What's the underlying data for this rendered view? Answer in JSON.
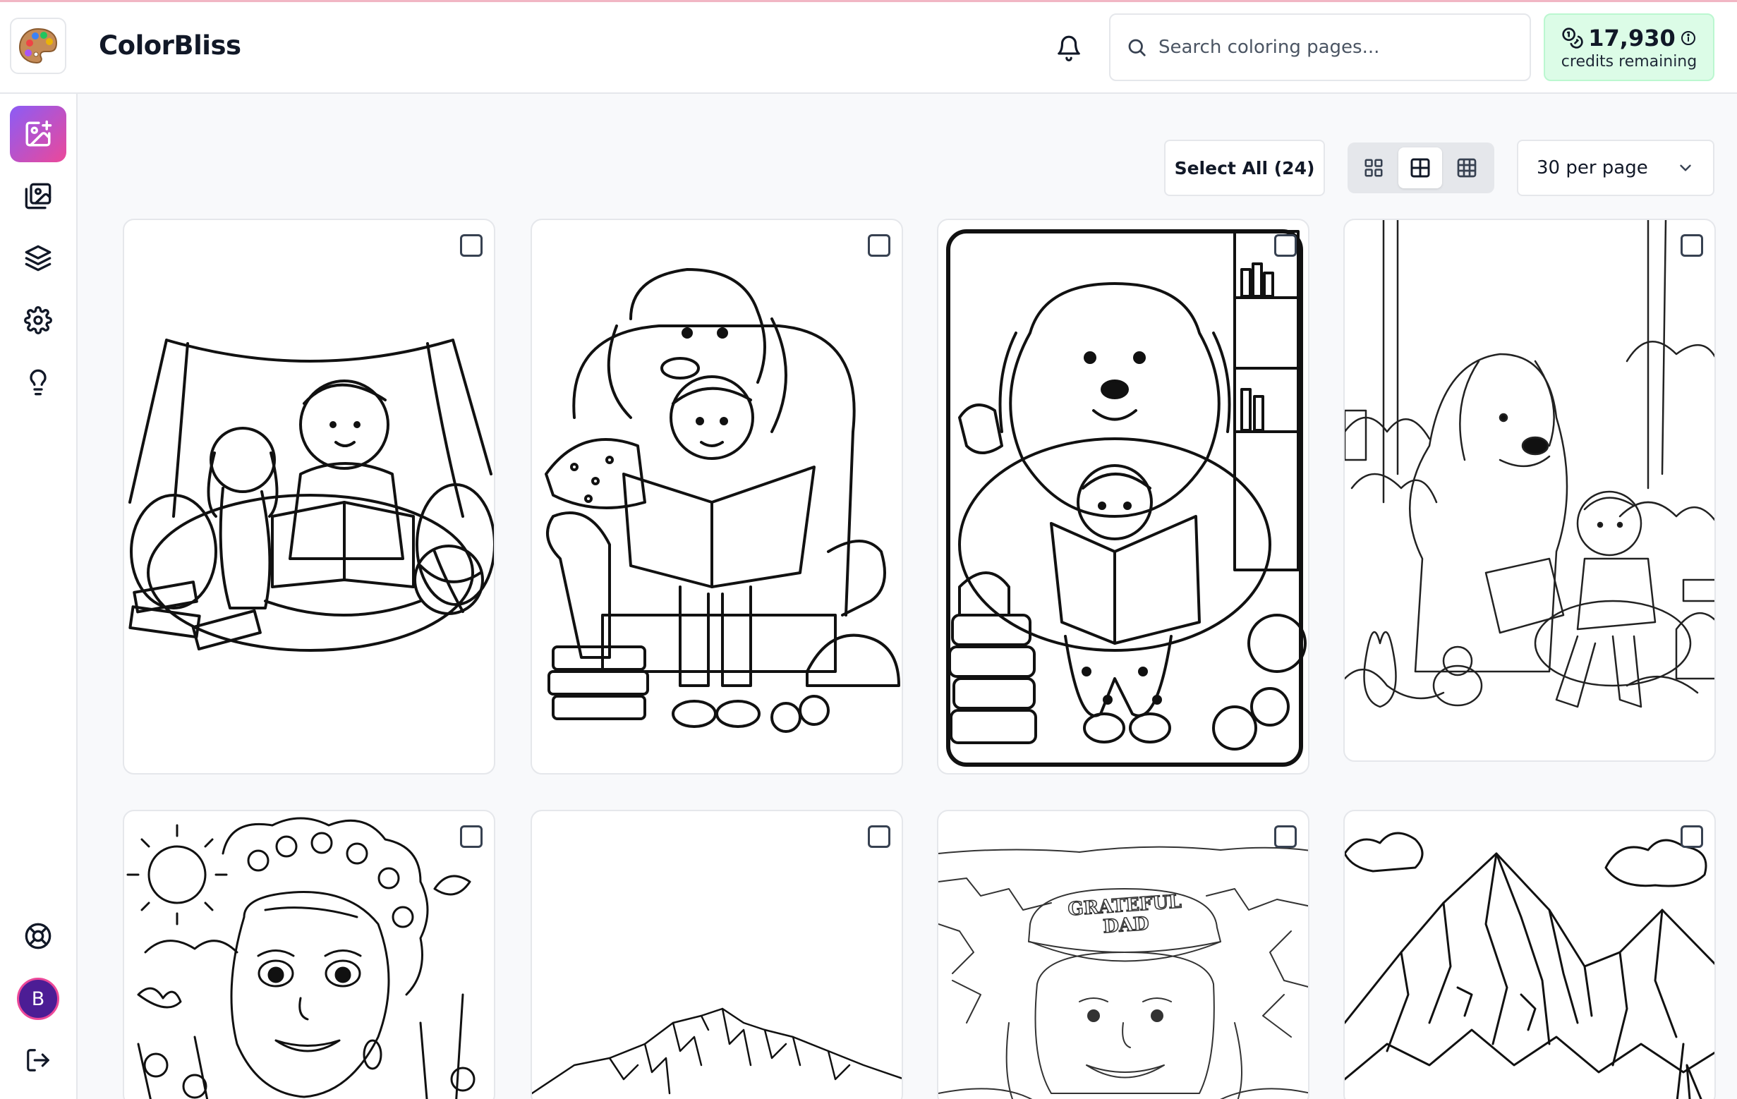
{
  "app": {
    "name": "ColorBliss"
  },
  "search": {
    "placeholder": "Search coloring pages..."
  },
  "credits": {
    "count": "17,930",
    "label": "credits remaining"
  },
  "toolbar": {
    "select_all_label": "Select All (24)",
    "per_page_label": "30 per page",
    "view_mode": "medium-grid"
  },
  "sidebar": {
    "items": [
      {
        "icon": "create-image-icon",
        "active": true
      },
      {
        "icon": "gallery-icon",
        "active": false
      },
      {
        "icon": "layers-icon",
        "active": false
      },
      {
        "icon": "settings-icon",
        "active": false
      },
      {
        "icon": "lightbulb-icon",
        "active": false
      }
    ],
    "bottom": [
      {
        "icon": "help-lifebuoy-icon"
      },
      {
        "icon": "logout-icon"
      }
    ]
  },
  "user": {
    "initial": "B"
  },
  "gallery": {
    "cards": [
      {
        "subject": "boy-and-dog-reading-in-fort",
        "selected": false
      },
      {
        "subject": "boy-and-dog-reading-in-armchair",
        "selected": false
      },
      {
        "subject": "girl-and-dog-reading-on-beanbag",
        "selected": false
      },
      {
        "subject": "dog-and-boy-reading-in-forest",
        "selected": false
      },
      {
        "subject": "girl-with-flower-crown",
        "selected": false
      },
      {
        "subject": "mountain-range",
        "selected": false
      },
      {
        "subject": "grateful-dad-canyon",
        "text": "GRATEFUL DAD",
        "selected": false
      },
      {
        "subject": "mountain-peaks-clouds",
        "selected": false
      }
    ]
  },
  "colors": {
    "accent_start": "#8b5cf6",
    "accent_end": "#ec4899",
    "credits_bg": "#dcfce7"
  }
}
